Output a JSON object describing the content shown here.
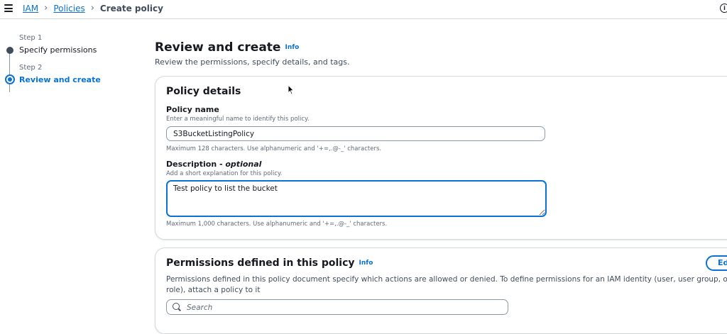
{
  "breadcrumb": {
    "items": [
      "IAM",
      "Policies"
    ],
    "current": "Create policy"
  },
  "steps": [
    {
      "label": "Step 1",
      "title": "Specify permissions"
    },
    {
      "label": "Step 2",
      "title": "Review and create"
    }
  ],
  "header": {
    "title": "Review and create",
    "info": "Info",
    "subtitle": "Review the permissions, specify details, and tags."
  },
  "policy_details": {
    "title": "Policy details",
    "name_label": "Policy name",
    "name_desc": "Enter a meaningful name to identify this policy.",
    "name_value": "S3BucketListingPolicy",
    "name_constraint": "Maximum 128 characters. Use alphanumeric and '+=,.@-_' characters.",
    "desc_label": "Description - ",
    "desc_optional": "optional",
    "desc_desc": "Add a short explanation for this policy.",
    "desc_value": "Test policy to list the bucket",
    "desc_constraint": "Maximum 1,000 characters. Use alphanumeric and '+=,.@-_' characters."
  },
  "permissions": {
    "title": "Permissions defined in this policy",
    "info": "Info",
    "description": "Permissions defined in this policy document specify which actions are allowed or denied. To define permissions for an IAM identity (user, user group, or role), attach a policy to it",
    "edit_label": "Edit",
    "search_placeholder": "Search"
  },
  "icons": {
    "menu": "hamburger-menu-icon",
    "help": "info-circle-icon",
    "search": "search-icon",
    "cursor": "mouse-pointer-icon"
  },
  "colors": {
    "accent": "#0972d3",
    "text": "#16191f",
    "muted": "#5f6b7a",
    "border": "#d5dbdb"
  }
}
